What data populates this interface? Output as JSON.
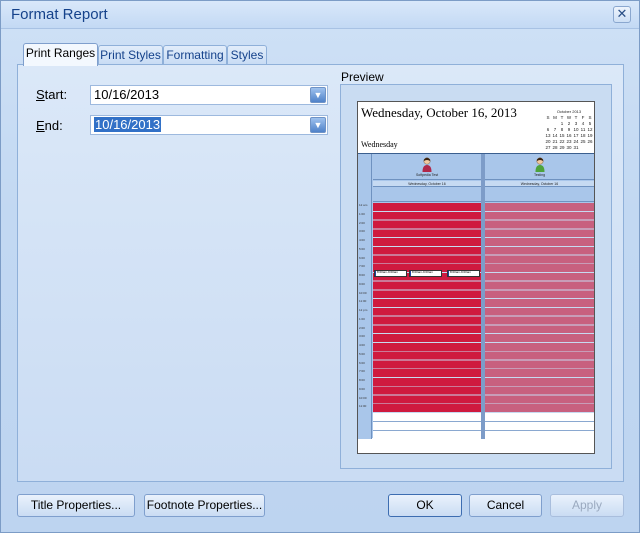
{
  "window": {
    "title": "Format Report"
  },
  "tabs": [
    {
      "label": "Print Ranges"
    },
    {
      "label": "Print Styles"
    },
    {
      "label": "Formatting"
    },
    {
      "label": "Styles"
    }
  ],
  "print_ranges": {
    "start_label_accel": "S",
    "start_label_rest": "tart:",
    "start_value": "10/16/2013",
    "end_label_accel": "E",
    "end_label_rest": "nd:",
    "end_value": "10/16/2013"
  },
  "preview": {
    "label": "Preview",
    "heading_date": "Wednesday, October 16, 2013",
    "heading_day": "Wednesday",
    "mini_calendar": {
      "title": "October 2013",
      "weekdays": [
        "S",
        "M",
        "T",
        "W",
        "T",
        "F",
        "S"
      ],
      "weeks": [
        [
          "",
          "",
          "1",
          "2",
          "3",
          "4",
          "5"
        ],
        [
          "6",
          "7",
          "8",
          "9",
          "10",
          "11",
          "12"
        ],
        [
          "13",
          "14",
          "15",
          "16",
          "17",
          "18",
          "19"
        ],
        [
          "20",
          "21",
          "22",
          "23",
          "24",
          "25",
          "26"
        ],
        [
          "27",
          "28",
          "29",
          "30",
          "31",
          "",
          ""
        ]
      ]
    },
    "resources": [
      {
        "name": "Softpedia Test",
        "day_label": "Wednesday, October 16",
        "color": "#cf1a3f",
        "avatar_color": "#b0284a"
      },
      {
        "name": "Testing",
        "day_label": "Wednesday, October 16",
        "color": "#c8607f",
        "avatar_color": "#4da33b"
      }
    ],
    "events": [
      "8:00am-9:00am",
      "8:00am-9:00am",
      "8:00am-9:00am"
    ],
    "time_labels": [
      "12 am",
      "1:00",
      "2:00",
      "3:00",
      "4:00",
      "5:00",
      "6:00",
      "7:00",
      "8:00",
      "9:00",
      "10:00",
      "11:00",
      "12 pm",
      "1:00",
      "2:00",
      "3:00",
      "4:00",
      "5:00",
      "6:00",
      "7:00",
      "8:00",
      "9:00",
      "10:00",
      "11:00"
    ]
  },
  "buttons": {
    "title_properties": "Title Properties...",
    "footnote_properties": "Footnote Properties...",
    "ok": "OK",
    "cancel": "Cancel",
    "apply": "Apply"
  },
  "colors": {
    "accent": "#15428b",
    "selection": "#3271c7"
  }
}
